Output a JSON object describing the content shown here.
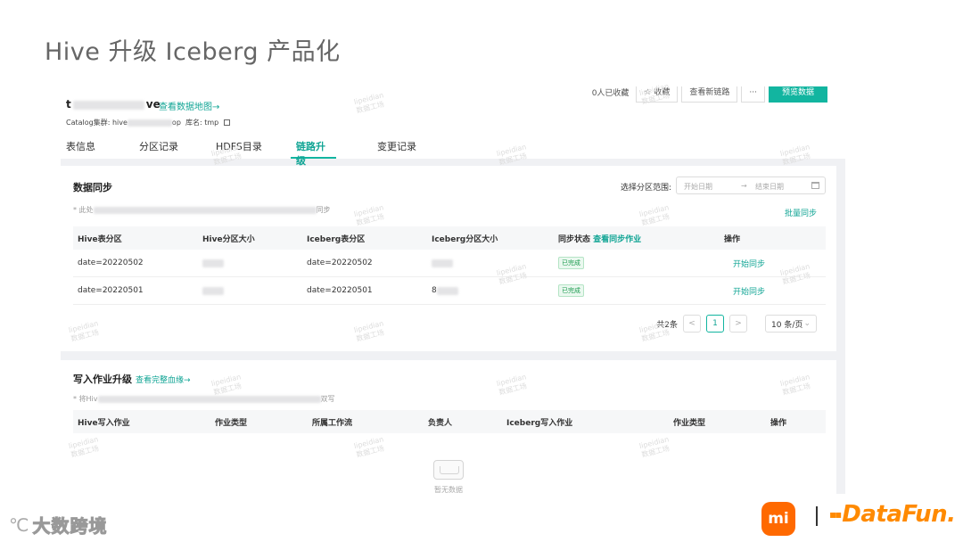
{
  "slide_title": "Hive 升级 Iceberg 产品化",
  "header": {
    "table_name_prefix": "t",
    "table_name_suffix": "ve",
    "map_link": "查看数据地图→",
    "catalog_label": "Catalog集群: hive",
    "catalog_suffix": "op",
    "db_label": "库名: tmp",
    "fav_count": "0人已收藏",
    "fav_button": "收藏",
    "lineage_button": "查看新链路",
    "more_button": "···",
    "preview_button": "预览数据"
  },
  "tabs": [
    "表信息",
    "分区记录",
    "HDFS目录",
    "链路升级",
    "变更记录"
  ],
  "active_tab": "链路升级",
  "sync": {
    "title": "数据同步",
    "range_label": "选择分区范围:",
    "start_placeholder": "开始日期",
    "arrow": "→",
    "end_placeholder": "结束日期",
    "note_prefix": "* 此处",
    "note_suffix": "同步",
    "batch_sync": "批量同步",
    "columns": [
      "Hive表分区",
      "Hive分区大小",
      "Iceberg表分区",
      "Iceberg分区大小",
      "同步状态",
      "操作"
    ],
    "status_link": "查看同步作业",
    "rows": [
      {
        "hive_partition": "date=20220502",
        "iceberg_partition": "date=20220502",
        "status": "已完成",
        "action": "开始同步"
      },
      {
        "hive_partition": "date=20220501",
        "iceberg_partition": "date=20220501",
        "iceberg_size_prefix": "8",
        "status": "已完成",
        "action": "开始同步"
      }
    ],
    "pager": {
      "total": "共2条",
      "prev": "<",
      "current": "1",
      "next": ">",
      "page_size": "10 条/页"
    }
  },
  "write": {
    "title": "写入作业升级",
    "lineage_link": "查看完整血缘→",
    "note_prefix": "* 将Hiv",
    "note_suffix": "双写",
    "columns": [
      "Hive写入作业",
      "作业类型",
      "所属工作流",
      "负责人",
      "Iceberg写入作业",
      "作业类型",
      "操作"
    ],
    "empty_text": "暂无数据"
  },
  "watermark": {
    "line1": "lipeidian",
    "line2": "数据工场"
  },
  "footer": {
    "left_logo": "大数跨境",
    "mi_logo": "mi",
    "datafun_logo": "DataFun."
  }
}
